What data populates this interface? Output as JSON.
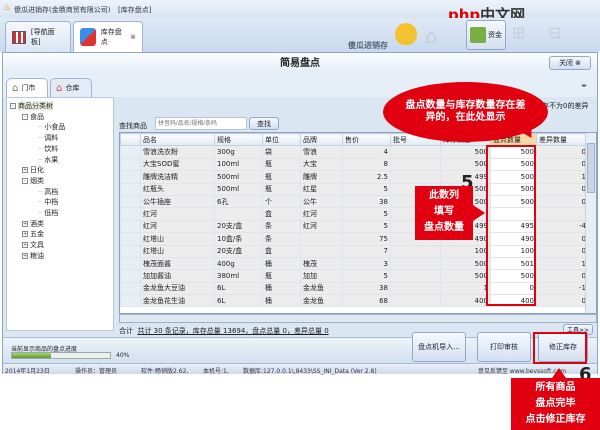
{
  "titlebar": {
    "title": "傻瓜进销存(金鼎商贸有限公司)",
    "module": "[库存盘点]"
  },
  "toptabs": [
    {
      "label": "[导航面板]"
    },
    {
      "label": "库存盘点"
    }
  ],
  "brand": {
    "logo_text": "傻瓜进销存",
    "toolbar_button": "资金"
  },
  "window": {
    "title": "简易盘点",
    "close_label": "关闭",
    "nav_arrows": "◂▸"
  },
  "store_tabs": [
    {
      "label": "门市"
    },
    {
      "label": "仓库"
    }
  ],
  "tree": {
    "root": "商品分类树",
    "nodes": [
      {
        "label": "食品",
        "level": 1,
        "toggle": "⊟"
      },
      {
        "label": "小食品",
        "level": 2
      },
      {
        "label": "调料",
        "level": 2
      },
      {
        "label": "饮料",
        "level": 2
      },
      {
        "label": "水果",
        "level": 2
      },
      {
        "label": "日化",
        "level": 1,
        "toggle": "⊞"
      },
      {
        "label": "烟类",
        "level": 1,
        "toggle": "⊟"
      },
      {
        "label": "高档",
        "level": 2
      },
      {
        "label": "中档",
        "level": 2
      },
      {
        "label": "低档",
        "level": 2
      },
      {
        "label": "酒类",
        "level": 1,
        "toggle": "⊞"
      },
      {
        "label": "五金",
        "level": 1,
        "toggle": "⊞"
      },
      {
        "label": "文具",
        "level": 1,
        "toggle": "⊞"
      },
      {
        "label": "粮油",
        "level": 1,
        "toggle": "⊞"
      }
    ]
  },
  "search": {
    "label": "查找商品",
    "placeholder": "拼音码/品名/规格/条码",
    "button": "查找"
  },
  "filter_text": "库存不为0的差异行",
  "grid": {
    "columns": [
      "品名",
      "规格",
      "单位",
      "品牌",
      "售价",
      "批号",
      "库存数量",
      "盘点数量",
      "差异数量"
    ],
    "rows": [
      [
        "雪浪洗衣粉",
        "300g",
        "袋",
        "雪浪",
        "4",
        "",
        "500",
        "500",
        "0"
      ],
      [
        "大宝SOD蜜",
        "100ml",
        "瓶",
        "大宝",
        "8",
        "",
        "500",
        "500",
        "0"
      ],
      [
        "雕牌洗洁精",
        "500ml",
        "瓶",
        "雕牌",
        "2.5",
        "",
        "499",
        "500",
        "1"
      ],
      [
        "红瓶头",
        "500ml",
        "瓶",
        "红星",
        "5",
        "",
        "500",
        "500",
        "0"
      ],
      [
        "公牛插座",
        "6孔",
        "个",
        "公牛",
        "38",
        "",
        "500",
        "500",
        "0"
      ],
      [
        "红河",
        "",
        "盒",
        "红河",
        "5",
        "",
        "",
        "",
        ""
      ],
      [
        "红河",
        "20支/盒",
        "条",
        "红河",
        "5",
        "",
        "499",
        "495",
        "-4"
      ],
      [
        "红塔山",
        "10盒/条",
        "条",
        "",
        "75",
        "",
        "490",
        "490",
        "0"
      ],
      [
        "红塔山",
        "20支/盒",
        "盒",
        "",
        "7",
        "",
        "100",
        "100",
        "0"
      ],
      [
        "槐茂面酱",
        "400g",
        "桶",
        "槐茂",
        "3",
        "",
        "500",
        "501",
        "1"
      ],
      [
        "加加酱油",
        "380ml",
        "瓶",
        "加加",
        "5",
        "",
        "500",
        "500",
        "0"
      ],
      [
        "金龙鱼大豆油",
        "6L",
        "桶",
        "金龙鱼",
        "38",
        "",
        "1",
        "0",
        "-1"
      ],
      [
        "金龙鱼花生油",
        "6L",
        "桶",
        "金龙鱼",
        "68",
        "",
        "400",
        "400",
        "0"
      ]
    ]
  },
  "summary": {
    "label": "合计",
    "text": "共计 30 条记录，库存总量 13694，盘点总量 0，差异总量 0",
    "tools": "工具>>"
  },
  "progress": {
    "label": "当前显示商品的盘点进度",
    "value": 40,
    "text": "40%"
  },
  "buttons": {
    "import": "盘点机导入...",
    "print": "打印审核",
    "fix": "修正库存"
  },
  "status": [
    "2014年1月23日",
    "操作员：管理员",
    "软件:畅销版2.62,",
    "本机号:1,",
    "数据库:127.0.0.1\\,8433\\SS_INI_Data (Ver 2.8)",
    "意见反馈至 www.bevssoft.com"
  ],
  "annotations": {
    "bubble": "盘点数量与库存数量存在差异的，在此处显示",
    "step5": "5",
    "step5_text": [
      "此数列",
      "填写",
      "盘点数量"
    ],
    "step6": "6",
    "step6_text": [
      "所有商品",
      "盘点完毕",
      "点击修正库存"
    ],
    "watermark": "php中文网"
  },
  "colors": {
    "accent_red": "#e00010",
    "progress": "#7cb342"
  }
}
